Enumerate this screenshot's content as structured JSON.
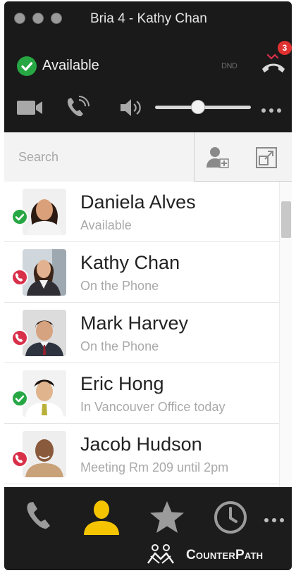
{
  "window": {
    "title": "Bria 4 - Kathy Chan"
  },
  "status": {
    "label": "Available",
    "dnd_label": "DND",
    "missed_calls": "3"
  },
  "search": {
    "placeholder": "Search"
  },
  "contacts": [
    {
      "name": "Daniela Alves",
      "status": "Available",
      "presence": "available"
    },
    {
      "name": "Kathy Chan",
      "status": "On the Phone",
      "presence": "on-phone"
    },
    {
      "name": "Mark Harvey",
      "status": "On the Phone",
      "presence": "on-phone"
    },
    {
      "name": "Eric Hong",
      "status": "In Vancouver Office today",
      "presence": "available"
    },
    {
      "name": "Jacob Hudson",
      "status": "Meeting Rm 209 until 2pm",
      "presence": "on-phone"
    }
  ],
  "volume": {
    "level": 0.45
  },
  "footer": {
    "brand": "CounterPath"
  },
  "colors": {
    "available": "#27a744",
    "busy": "#d9304a",
    "active_tab": "#f5c400",
    "badge": "#e03131"
  }
}
